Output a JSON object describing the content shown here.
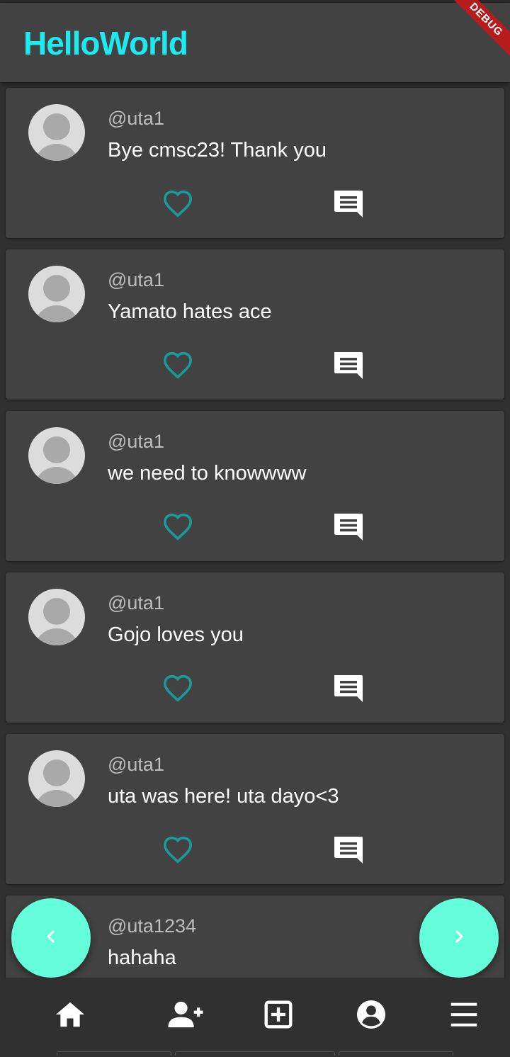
{
  "app": {
    "title": "HelloWorld",
    "debug_banner": "DEBUG"
  },
  "colors": {
    "accent": "#1de9f0",
    "fab": "#64ffda",
    "heart": "#1a9a9a",
    "card": "#424242",
    "background": "#303030"
  },
  "posts": [
    {
      "username": "@uta1",
      "text": "Bye cmsc23! Thank you"
    },
    {
      "username": "@uta1",
      "text": "Yamato hates ace"
    },
    {
      "username": "@uta1",
      "text": "we need to knowwww"
    },
    {
      "username": "@uta1",
      "text": "Gojo loves you"
    },
    {
      "username": "@uta1",
      "text": "uta was here! uta dayo<3"
    },
    {
      "username": "@uta1234",
      "text": "hahaha"
    }
  ],
  "post_actions": {
    "like_icon": "heart-outline-icon",
    "comment_icon": "comment-icon"
  },
  "fabs": {
    "previous_icon": "chevron-left-icon",
    "next_icon": "chevron-right-icon"
  },
  "bottom_nav": [
    {
      "icon": "home-icon"
    },
    {
      "icon": "person-add-icon"
    },
    {
      "icon": "add-box-icon"
    },
    {
      "icon": "account-circle-icon"
    },
    {
      "icon": "menu-icon"
    }
  ]
}
